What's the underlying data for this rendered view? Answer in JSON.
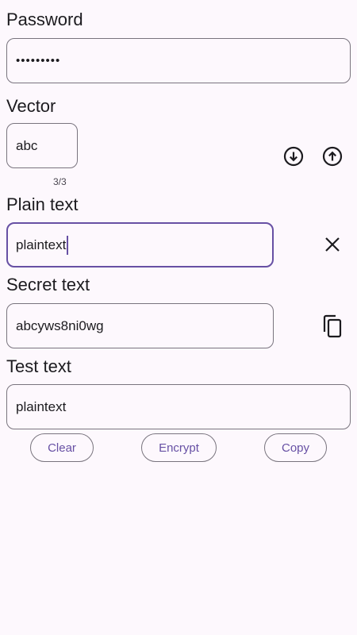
{
  "password": {
    "label": "Password",
    "value": "•••••••••"
  },
  "vector": {
    "label": "Vector",
    "value": "abc",
    "counter": "3/3",
    "download_icon": "arrow-down-circle-icon",
    "upload_icon": "arrow-up-circle-icon"
  },
  "plain_text": {
    "label": "Plain text",
    "value": "plaintext",
    "clear_icon": "close-icon"
  },
  "secret_text": {
    "label": "Secret text",
    "value": "abcyws8ni0wg",
    "copy_icon": "copy-icon"
  },
  "test_text": {
    "label": "Test text",
    "value": "plaintext"
  },
  "actions": {
    "clear_label": "Clear",
    "encrypt_label": "Encrypt",
    "copy_label": "Copy"
  },
  "colors": {
    "background": "#fdf8fd",
    "primary": "#6750a4",
    "outline": "#79747e"
  }
}
